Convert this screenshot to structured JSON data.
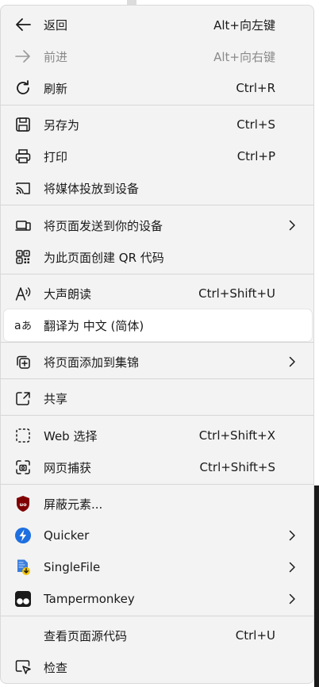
{
  "menu": {
    "back": {
      "label": "返回",
      "shortcut": "Alt+向左键",
      "icon": "back-arrow-icon"
    },
    "forward": {
      "label": "前进",
      "shortcut": "Alt+向右键",
      "icon": "forward-arrow-icon"
    },
    "refresh": {
      "label": "刷新",
      "shortcut": "Ctrl+R",
      "icon": "refresh-icon"
    },
    "save_as": {
      "label": "另存为",
      "shortcut": "Ctrl+S",
      "icon": "save-icon"
    },
    "print": {
      "label": "打印",
      "shortcut": "Ctrl+P",
      "icon": "printer-icon"
    },
    "cast": {
      "label": "将媒体投放到设备",
      "icon": "cast-icon"
    },
    "send_page": {
      "label": "将页面发送到你的设备",
      "icon": "devices-icon"
    },
    "qr_code": {
      "label": "为此页面创建 QR 代码",
      "icon": "qr-code-icon"
    },
    "read_aloud": {
      "label": "大声朗读",
      "shortcut": "Ctrl+Shift+U",
      "icon": "read-aloud-icon"
    },
    "translate": {
      "label": "翻译为 中文 (简体)",
      "icon": "translate-icon"
    },
    "add_collection": {
      "label": "将页面添加到集锦",
      "icon": "collections-icon"
    },
    "share": {
      "label": "共享",
      "icon": "share-icon"
    },
    "web_select": {
      "label": "Web 选择",
      "shortcut": "Ctrl+Shift+X",
      "icon": "web-select-icon"
    },
    "web_capture": {
      "label": "网页捕获",
      "shortcut": "Ctrl+Shift+S",
      "icon": "web-capture-icon"
    },
    "block_element": {
      "label": "屏蔽元素...",
      "icon": "ublock-icon"
    },
    "quicker": {
      "label": "Quicker",
      "icon": "quicker-icon"
    },
    "singlefile": {
      "label": "SingleFile",
      "icon": "singlefile-icon"
    },
    "tampermonkey": {
      "label": "Tampermonkey",
      "icon": "tampermonkey-icon"
    },
    "view_source": {
      "label": "查看页面源代码",
      "shortcut": "Ctrl+U"
    },
    "inspect": {
      "label": "检查",
      "icon": "inspect-icon"
    }
  },
  "colors": {
    "menu_bg": "#f3f3f3",
    "highlight_bg": "#ffffff",
    "text": "#1a1a1a",
    "disabled_text": "#8a8a8a",
    "separator": "#d6d6d6",
    "quicker_blue": "#1e6fe0",
    "ublock_red": "#800000"
  }
}
